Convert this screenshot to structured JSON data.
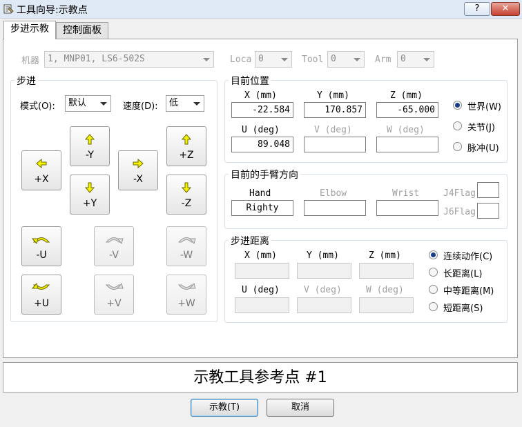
{
  "window": {
    "title": "工具向导:示教点",
    "help_label": "?",
    "close_label": "✕"
  },
  "tabs": [
    {
      "label": "步进示教"
    },
    {
      "label": "控制面板"
    }
  ],
  "robot": {
    "robot_label": "机器",
    "robot_value": "1, MNP01, LS6-502S",
    "loca_label": "Loca",
    "loca_value": "0",
    "tool_label": "Tool",
    "tool_value": "0",
    "arm_label": "Arm",
    "arm_value": "0"
  },
  "jog": {
    "title": "步进",
    "mode_label": "模式(O):",
    "mode_value": "默认",
    "speed_label": "速度(D):",
    "speed_value": "低",
    "buttons": {
      "plus_x": "+X",
      "minus_x": "-X",
      "minus_y": "-Y",
      "plus_y": "+Y",
      "plus_z": "+Z",
      "minus_z": "-Z",
      "minus_u": "-U",
      "plus_u": "+U",
      "minus_v": "-V",
      "plus_v": "+V",
      "minus_w": "-W",
      "plus_w": "+W"
    }
  },
  "current_position": {
    "title": "目前位置",
    "x_label": "X (mm)",
    "x_value": "-22.584",
    "y_label": "Y (mm)",
    "y_value": "170.857",
    "z_label": "Z (mm)",
    "z_value": "-65.000",
    "u_label": "U (deg)",
    "u_value": "89.048",
    "v_label": "V (deg)",
    "v_value": "",
    "w_label": "W (deg)",
    "w_value": "",
    "modes": [
      {
        "label": "世界(W)",
        "selected": true
      },
      {
        "label": "关节(J)",
        "selected": false
      },
      {
        "label": "脉冲(U)",
        "selected": false
      }
    ]
  },
  "arm_orientation": {
    "title": "目前的手臂方向",
    "hand_label": "Hand",
    "hand_value": "Righty",
    "elbow_label": "Elbow",
    "elbow_value": "",
    "wrist_label": "Wrist",
    "wrist_value": "",
    "j4flag_label": "J4Flag",
    "j6flag_label": "J6Flag"
  },
  "jog_distance": {
    "title": "步进距离",
    "x_label": "X (mm)",
    "y_label": "Y (mm)",
    "z_label": "Z (mm)",
    "u_label": "U (deg)",
    "v_label": "V (deg)",
    "w_label": "W (deg)",
    "modes": [
      {
        "label": "连续动作(C)",
        "selected": true
      },
      {
        "label": "长距离(L)",
        "selected": false
      },
      {
        "label": "中等距离(M)",
        "selected": false
      },
      {
        "label": "短距离(S)",
        "selected": false
      }
    ]
  },
  "status": {
    "text": "示教工具参考点 #1"
  },
  "footer": {
    "teach_label": "示教(T)",
    "cancel_label": "取消"
  },
  "colors": {
    "arrow_fill": "#f6f200",
    "arrow_stroke": "#6a6a00",
    "radio_dot": "#1a3f8a"
  }
}
